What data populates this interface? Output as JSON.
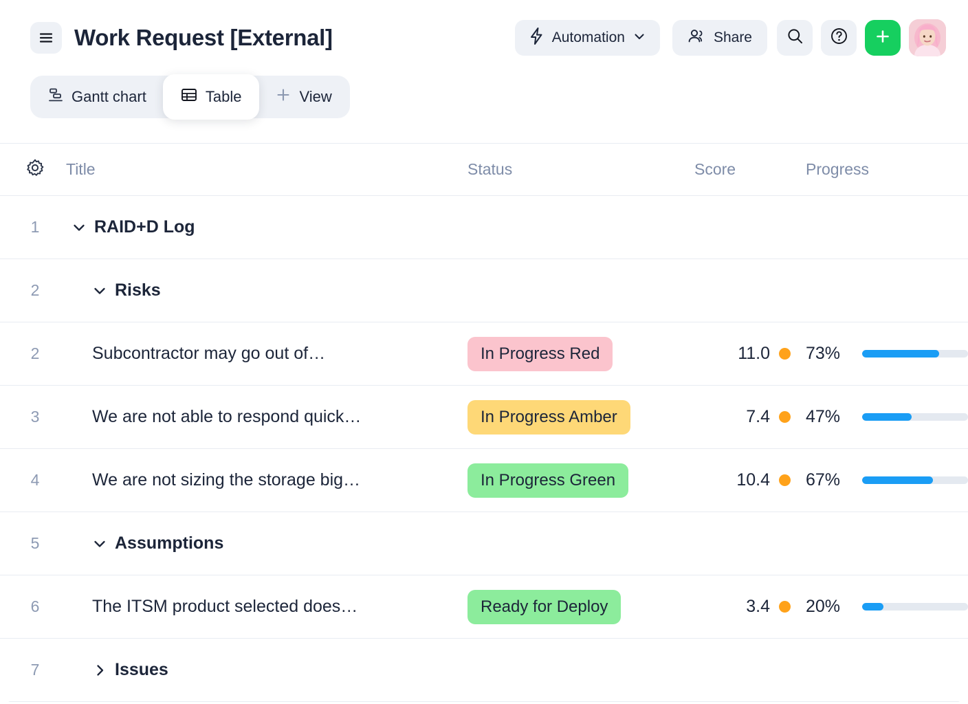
{
  "header": {
    "title": "Work Request [External]",
    "menu_icon": "hamburger-icon",
    "automation": {
      "label": "Automation",
      "icon": "lightning-bolt-icon",
      "caret": "chevron-down-icon"
    },
    "share": {
      "label": "Share",
      "icon": "people-icon"
    },
    "search_icon": "search-icon",
    "help_icon": "question-mark-icon",
    "add_icon": "plus-icon",
    "add_button_color": "#16cf5f",
    "avatar": "user-avatar"
  },
  "tabs": [
    {
      "label": "Gantt chart",
      "icon": "gantt-chart-icon",
      "active": false
    },
    {
      "label": "Table",
      "icon": "table-grid-icon",
      "active": true
    },
    {
      "label": "View",
      "icon": "plus-icon",
      "active": false,
      "is_add": true
    }
  ],
  "table": {
    "settings_icon": "gear-icon",
    "columns": {
      "title": "Title",
      "status": "Status",
      "score": "Score",
      "progress": "Progress"
    },
    "rows": [
      {
        "num": "1",
        "title": "RAID+D Log",
        "indent": 1,
        "group": true,
        "expanded": true,
        "chevron": "chevron-down-icon",
        "status": "",
        "status_color": "",
        "score": "",
        "percent": "",
        "progress": null
      },
      {
        "num": "2",
        "title": "Risks",
        "indent": 2,
        "group": true,
        "expanded": true,
        "chevron": "chevron-down-icon",
        "status": "",
        "status_color": "",
        "score": "",
        "percent": "",
        "progress": null
      },
      {
        "num": "2",
        "title": "Subcontractor may go out of…",
        "indent": 2,
        "group": false,
        "expanded": null,
        "chevron": "",
        "status": "In Progress Red",
        "status_color": "#fbc4cd",
        "score": "11.0",
        "score_dot_color": "#ffa21a",
        "percent": "73%",
        "progress": 73
      },
      {
        "num": "3",
        "title": "We are not able to respond quick…",
        "indent": 2,
        "group": false,
        "expanded": null,
        "chevron": "",
        "status": "In Progress Amber",
        "status_color": "#fed877",
        "score": "7.4",
        "score_dot_color": "#ffa21a",
        "percent": "47%",
        "progress": 47
      },
      {
        "num": "4",
        "title": "We are not sizing the storage big…",
        "indent": 2,
        "group": false,
        "expanded": null,
        "chevron": "",
        "status": "In Progress Green",
        "status_color": "#8cec9c",
        "score": "10.4",
        "score_dot_color": "#ffa21a",
        "percent": "67%",
        "progress": 67
      },
      {
        "num": "5",
        "title": "Assumptions",
        "indent": 2,
        "group": true,
        "expanded": true,
        "chevron": "chevron-down-icon",
        "status": "",
        "status_color": "",
        "score": "",
        "percent": "",
        "progress": null
      },
      {
        "num": "6",
        "title": "The ITSM product selected does…",
        "indent": 2,
        "group": false,
        "expanded": null,
        "chevron": "",
        "status": "Ready for Deploy",
        "status_color": "#8cec9c",
        "score": "3.4",
        "score_dot_color": "#ffa21a",
        "percent": "20%",
        "progress": 20
      },
      {
        "num": "7",
        "title": "Issues",
        "indent": 2,
        "group": true,
        "expanded": false,
        "chevron": "chevron-right-icon",
        "status": "",
        "status_color": "",
        "score": "",
        "percent": "",
        "progress": null
      }
    ]
  }
}
